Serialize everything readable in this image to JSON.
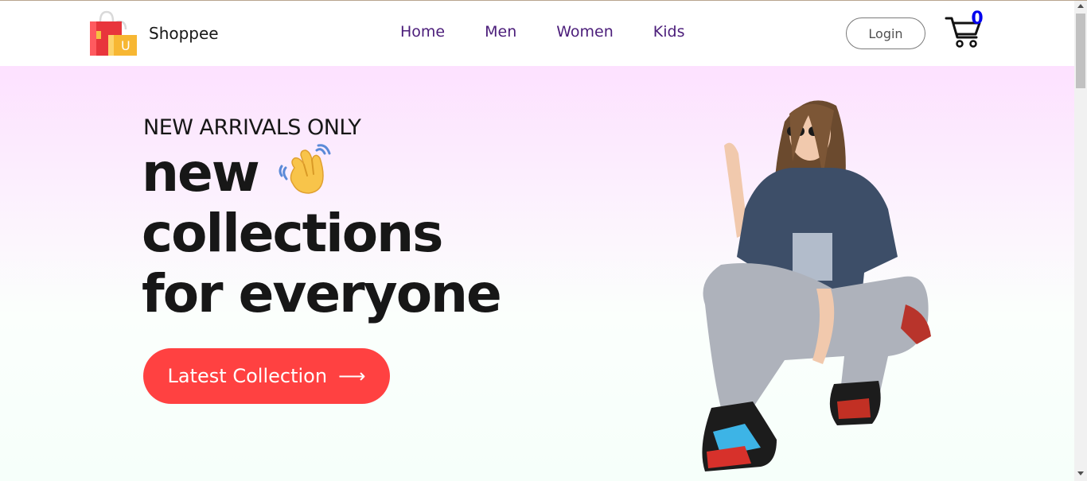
{
  "brand": {
    "name": "Shoppee",
    "logo_letter": "U"
  },
  "nav": {
    "items": [
      {
        "label": "Home"
      },
      {
        "label": "Men"
      },
      {
        "label": "Women"
      },
      {
        "label": "Kids"
      }
    ]
  },
  "header": {
    "login_label": "Login",
    "cart_count": "0",
    "cart_icon": "cart-icon"
  },
  "hero": {
    "kicker": "NEW ARRIVALS ONLY",
    "line1": "new",
    "line2": "collections",
    "line3": "for everyone",
    "hand_icon": "waving-hand-icon",
    "cta_label": "Latest Collection",
    "cta_arrow": "⟶"
  },
  "colors": {
    "accent": "#ff4141",
    "nav_text": "#4b1d7a",
    "hero_bg_top": "#fde1ff",
    "cart_badge": "#0000ee"
  }
}
